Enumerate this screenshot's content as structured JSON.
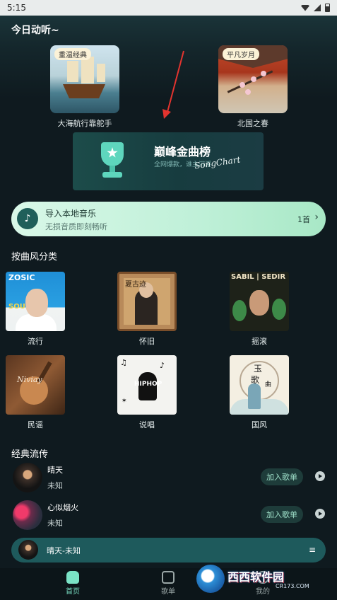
{
  "status_bar": {
    "time": "5:15"
  },
  "header": {
    "title": "今日动听~"
  },
  "featured": [
    {
      "tag": "重温经典",
      "caption": "大海航行靠舵手"
    },
    {
      "tag": "平凡岁月",
      "caption": "北国之春"
    }
  ],
  "banner": {
    "title": "巅峰金曲榜",
    "subtitle": "全网爆款，谁主沉浮",
    "brand": "SongChart"
  },
  "import": {
    "title": "导入本地音乐",
    "subtitle": "无损音质即刻畅听",
    "count": "1首",
    "chevron": "›"
  },
  "genres_section": {
    "title": "按曲风分类",
    "items": [
      {
        "label": "流行",
        "cover_text_1": "ZOSIC",
        "cover_text_2": "SOUS"
      },
      {
        "label": "怀旧",
        "cover_text_1": "夏古迹"
      },
      {
        "label": "摇滚",
        "cover_text_1": "SABIL | SEDIR"
      },
      {
        "label": "民谣",
        "cover_text_1": "Niviay"
      },
      {
        "label": "说唱",
        "cover_text_1": "HIPHOP"
      },
      {
        "label": "国风",
        "cover_text_1": "玉",
        "cover_text_2": "歌",
        "cover_text_3": "曲"
      }
    ]
  },
  "classics_section": {
    "title": "经典流传",
    "songs": [
      {
        "title": "晴天",
        "artist": "未知",
        "add_label": "加入歌单"
      },
      {
        "title": "心似烟火",
        "artist": "未知",
        "add_label": "加入歌单"
      }
    ]
  },
  "mini_player": {
    "title": "晴天-未知",
    "list_icon": "≡"
  },
  "bottom_nav": {
    "home": "首页",
    "playlist": "歌单",
    "me": "我的"
  },
  "watermark": {
    "text": "西西软件园",
    "sub": "CR173.COM"
  },
  "colors": {
    "accent": "#7be3c6",
    "background": "#0f1a1f",
    "import_card": "#bff0d8",
    "annotation_arrow": "#e3342f"
  }
}
